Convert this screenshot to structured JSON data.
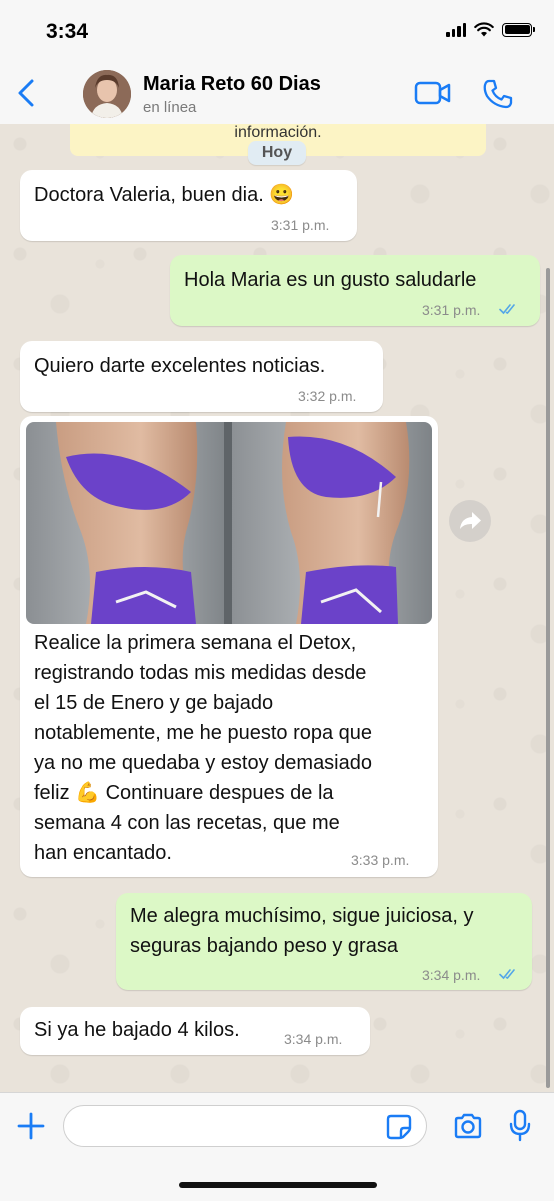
{
  "status_bar": {
    "time": "3:34"
  },
  "header": {
    "contact_name": "Maria Reto 60 Dias",
    "contact_status": "en línea"
  },
  "banner": {
    "text": "información."
  },
  "date_separator": "Hoy",
  "messages": [
    {
      "direction": "incoming",
      "text": "Doctora Valeria, buen dia. 😀",
      "time": "3:31 p.m."
    },
    {
      "direction": "outgoing",
      "text": "Hola Maria es un gusto saludarle",
      "time": "3:31 p.m.",
      "status": "read"
    },
    {
      "direction": "incoming",
      "text": "Quiero darte excelentes noticias.",
      "time": "3:32 p.m."
    },
    {
      "direction": "incoming",
      "type": "image",
      "caption_lines": [
        "Realice la primera semana el Detox,",
        "registrando todas mis medidas desde",
        "el 15 de Enero y ge bajado",
        "notablemente, me he puesto ropa que",
        "ya no me quedaba y estoy demasiado",
        "feliz 💪 Continuare despues de la",
        "semana 4 con las recetas, que me",
        "han encantado."
      ],
      "time": "3:33 p.m."
    },
    {
      "direction": "outgoing",
      "text_lines": [
        "Me alegra muchísimo, sigue juiciosa, y",
        "seguras bajando peso y grasa"
      ],
      "time": "3:34 p.m.",
      "status": "read"
    },
    {
      "direction": "incoming",
      "text": "Si ya he bajado 4 kilos.",
      "time": "3:34 p.m."
    }
  ],
  "composer": {
    "value": "",
    "placeholder": ""
  },
  "icons": {
    "back": "chevron-left-icon",
    "video": "video-camera-icon",
    "phone": "phone-icon",
    "forward": "forward-icon",
    "plus": "plus-icon",
    "sticker": "sticker-icon",
    "camera": "camera-icon",
    "mic": "microphone-icon"
  },
  "colors": {
    "accent": "#1A7CF5",
    "incoming_bubble": "#FFFFFF",
    "outgoing_bubble": "#DCF8C6",
    "read_ticks": "#53A6E8",
    "banner": "#FCF4C5"
  }
}
